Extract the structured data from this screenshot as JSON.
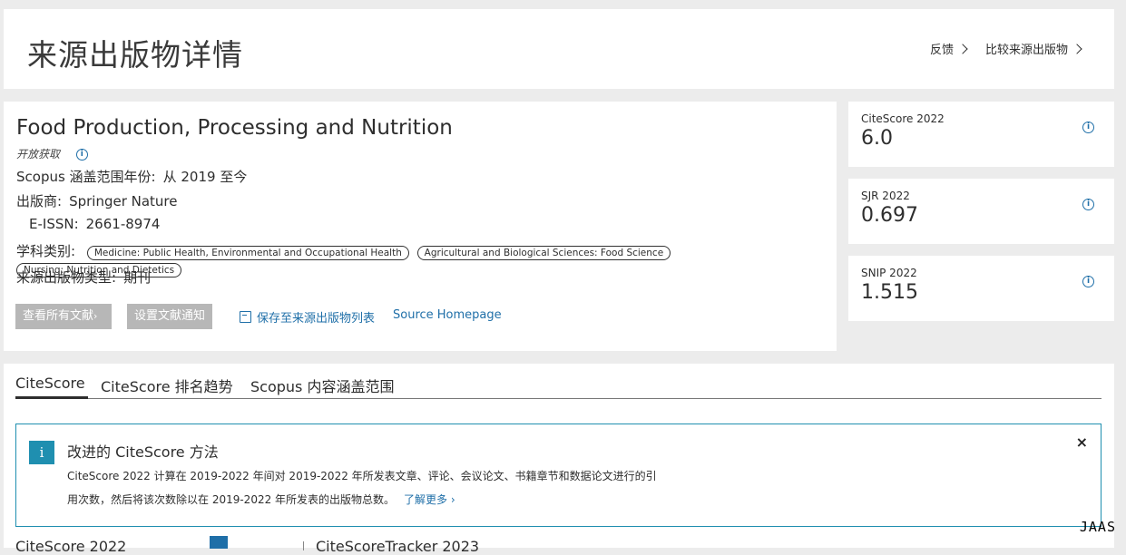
{
  "header": {
    "title": "来源出版物详情",
    "feedback_label": "反馈",
    "compare_label": "比较来源出版物"
  },
  "source": {
    "title": "Food Production, Processing and Nutrition",
    "open_access": "开放获取",
    "coverage_label": "Scopus 涵盖范围年份:",
    "coverage_value": "从 2019 至今",
    "publisher_label": "出版商:",
    "publisher_value": "Springer Nature",
    "eissn_label": "E-ISSN:",
    "eissn_value": "2661-8974",
    "subject_label": "学科类别:",
    "subjects": [
      "Medicine: Public Health, Environmental and Occupational Health",
      "Agricultural and Biological Sciences: Food Science",
      "Nursing: Nutrition and Dietetics"
    ],
    "type_label": "来源出版物类型:",
    "type_value": "期刊",
    "view_all_button": "查看所有文献",
    "set_alert_button": "设置文献通知",
    "save_link": "保存至来源出版物列表",
    "homepage_link": "Source Homepage"
  },
  "metrics": [
    {
      "label": "CiteScore 2022",
      "value": "6.0"
    },
    {
      "label": "SJR 2022",
      "value": "0.697"
    },
    {
      "label": "SNIP 2022",
      "value": "1.515"
    }
  ],
  "tabs": [
    {
      "label": "CiteScore",
      "active": true
    },
    {
      "label": "CiteScore 排名趋势",
      "active": false
    },
    {
      "label": "Scopus 内容涵盖范围",
      "active": false
    }
  ],
  "notice": {
    "icon": "i",
    "title": "改进的 CiteScore 方法",
    "line1": "CiteScore 2022 计算在 2019-2022 年间对 2019-2022 年所发表文章、评论、会议论文、书籍章节和数据论文进行的引",
    "line2": "用次数，然后将该次数除以在 2019-2022 年所发表的出版物总数。",
    "learn_more": "了解更多",
    "close": "×"
  },
  "bottom": {
    "left_partial": "CiteScore 2022",
    "right_partial": "CiteScoreTracker 2023"
  },
  "watermark": "JAAS",
  "colors": {
    "accent": "#1f6fa8",
    "notice_border": "#1f8fb0",
    "disabled_button": "#b7b7b7"
  }
}
